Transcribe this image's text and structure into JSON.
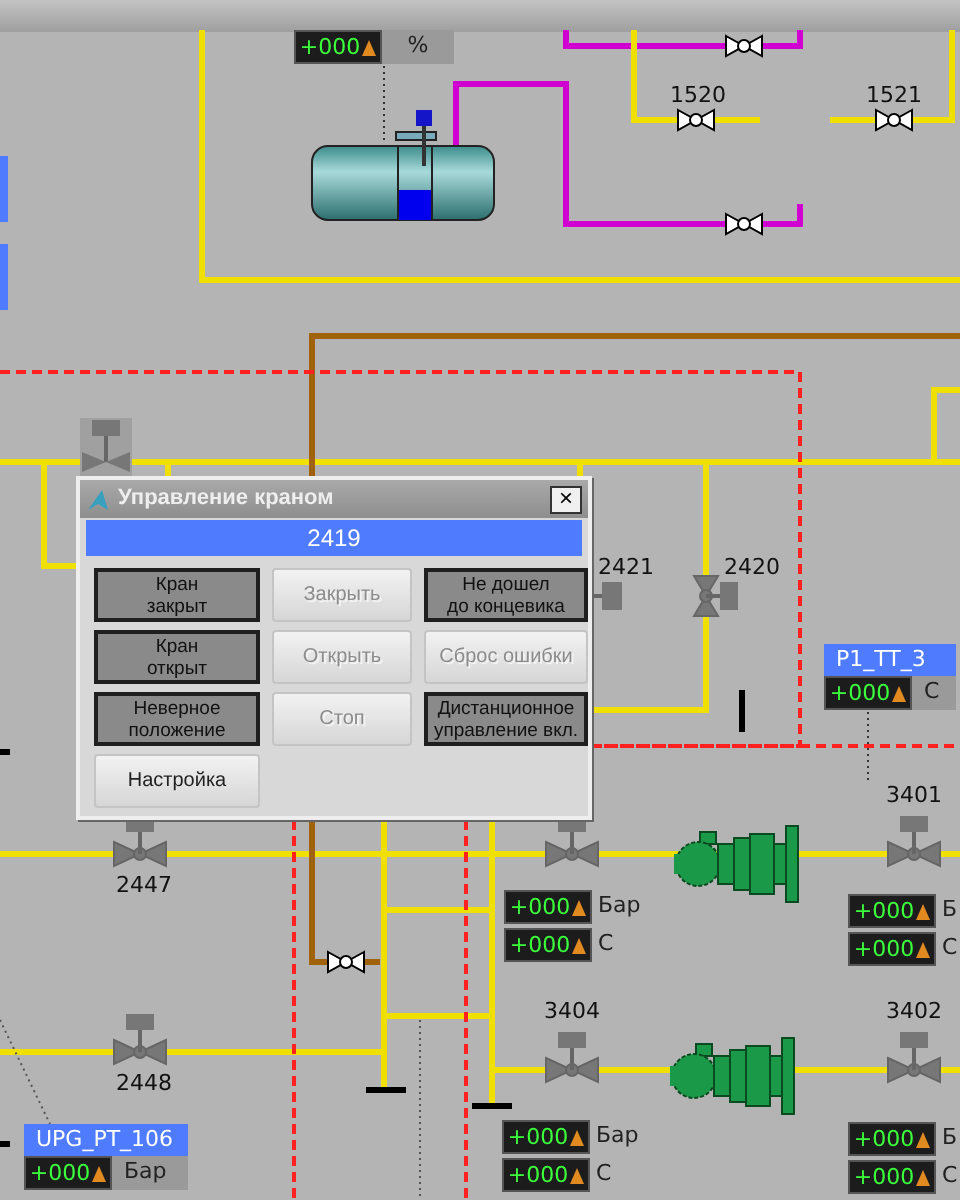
{
  "level_meter": {
    "value": "+000",
    "unit": "%"
  },
  "valve_labels": [
    "1520",
    "1521",
    "2421",
    "2420",
    "2447",
    "3401",
    "2448",
    "3404",
    "3402"
  ],
  "tags": [
    {
      "name": "P1_TT_3",
      "value": "+000",
      "unit": "С"
    },
    {
      "name": "UPG_PT_106",
      "value": "+000",
      "unit": "Бар"
    }
  ],
  "pump_readouts": [
    {
      "value": "+000",
      "unit": "Бар"
    },
    {
      "value": "+000",
      "unit": "Б"
    },
    {
      "value": "+000",
      "unit": "С"
    },
    {
      "value": "+000",
      "unit": "С"
    },
    {
      "value": "+000",
      "unit": "Бар"
    },
    {
      "value": "+000",
      "unit": "Б"
    },
    {
      "value": "+000",
      "unit": "С"
    },
    {
      "value": "+000",
      "unit": "С"
    }
  ],
  "dialog": {
    "title": "Управление краном",
    "close": "×",
    "valve_id": "2419",
    "cells": [
      {
        "kind": "indicator",
        "label": "Кран\nзакрыт"
      },
      {
        "kind": "button",
        "label": "Закрыть",
        "disabled": true
      },
      {
        "kind": "indicator",
        "label": "Не дошел\nдо концевика"
      },
      {
        "kind": "indicator",
        "label": "Кран\nоткрыт"
      },
      {
        "kind": "button",
        "label": "Открыть",
        "disabled": true
      },
      {
        "kind": "button",
        "label": "Сброс ошибки",
        "disabled": true
      },
      {
        "kind": "indicator",
        "label": "Неверное\nположение"
      },
      {
        "kind": "button",
        "label": "Стоп",
        "disabled": true
      },
      {
        "kind": "indicator",
        "label": "Дистанционное\nуправление вкл."
      },
      {
        "kind": "button",
        "label": "Настройка",
        "disabled": false
      }
    ]
  }
}
